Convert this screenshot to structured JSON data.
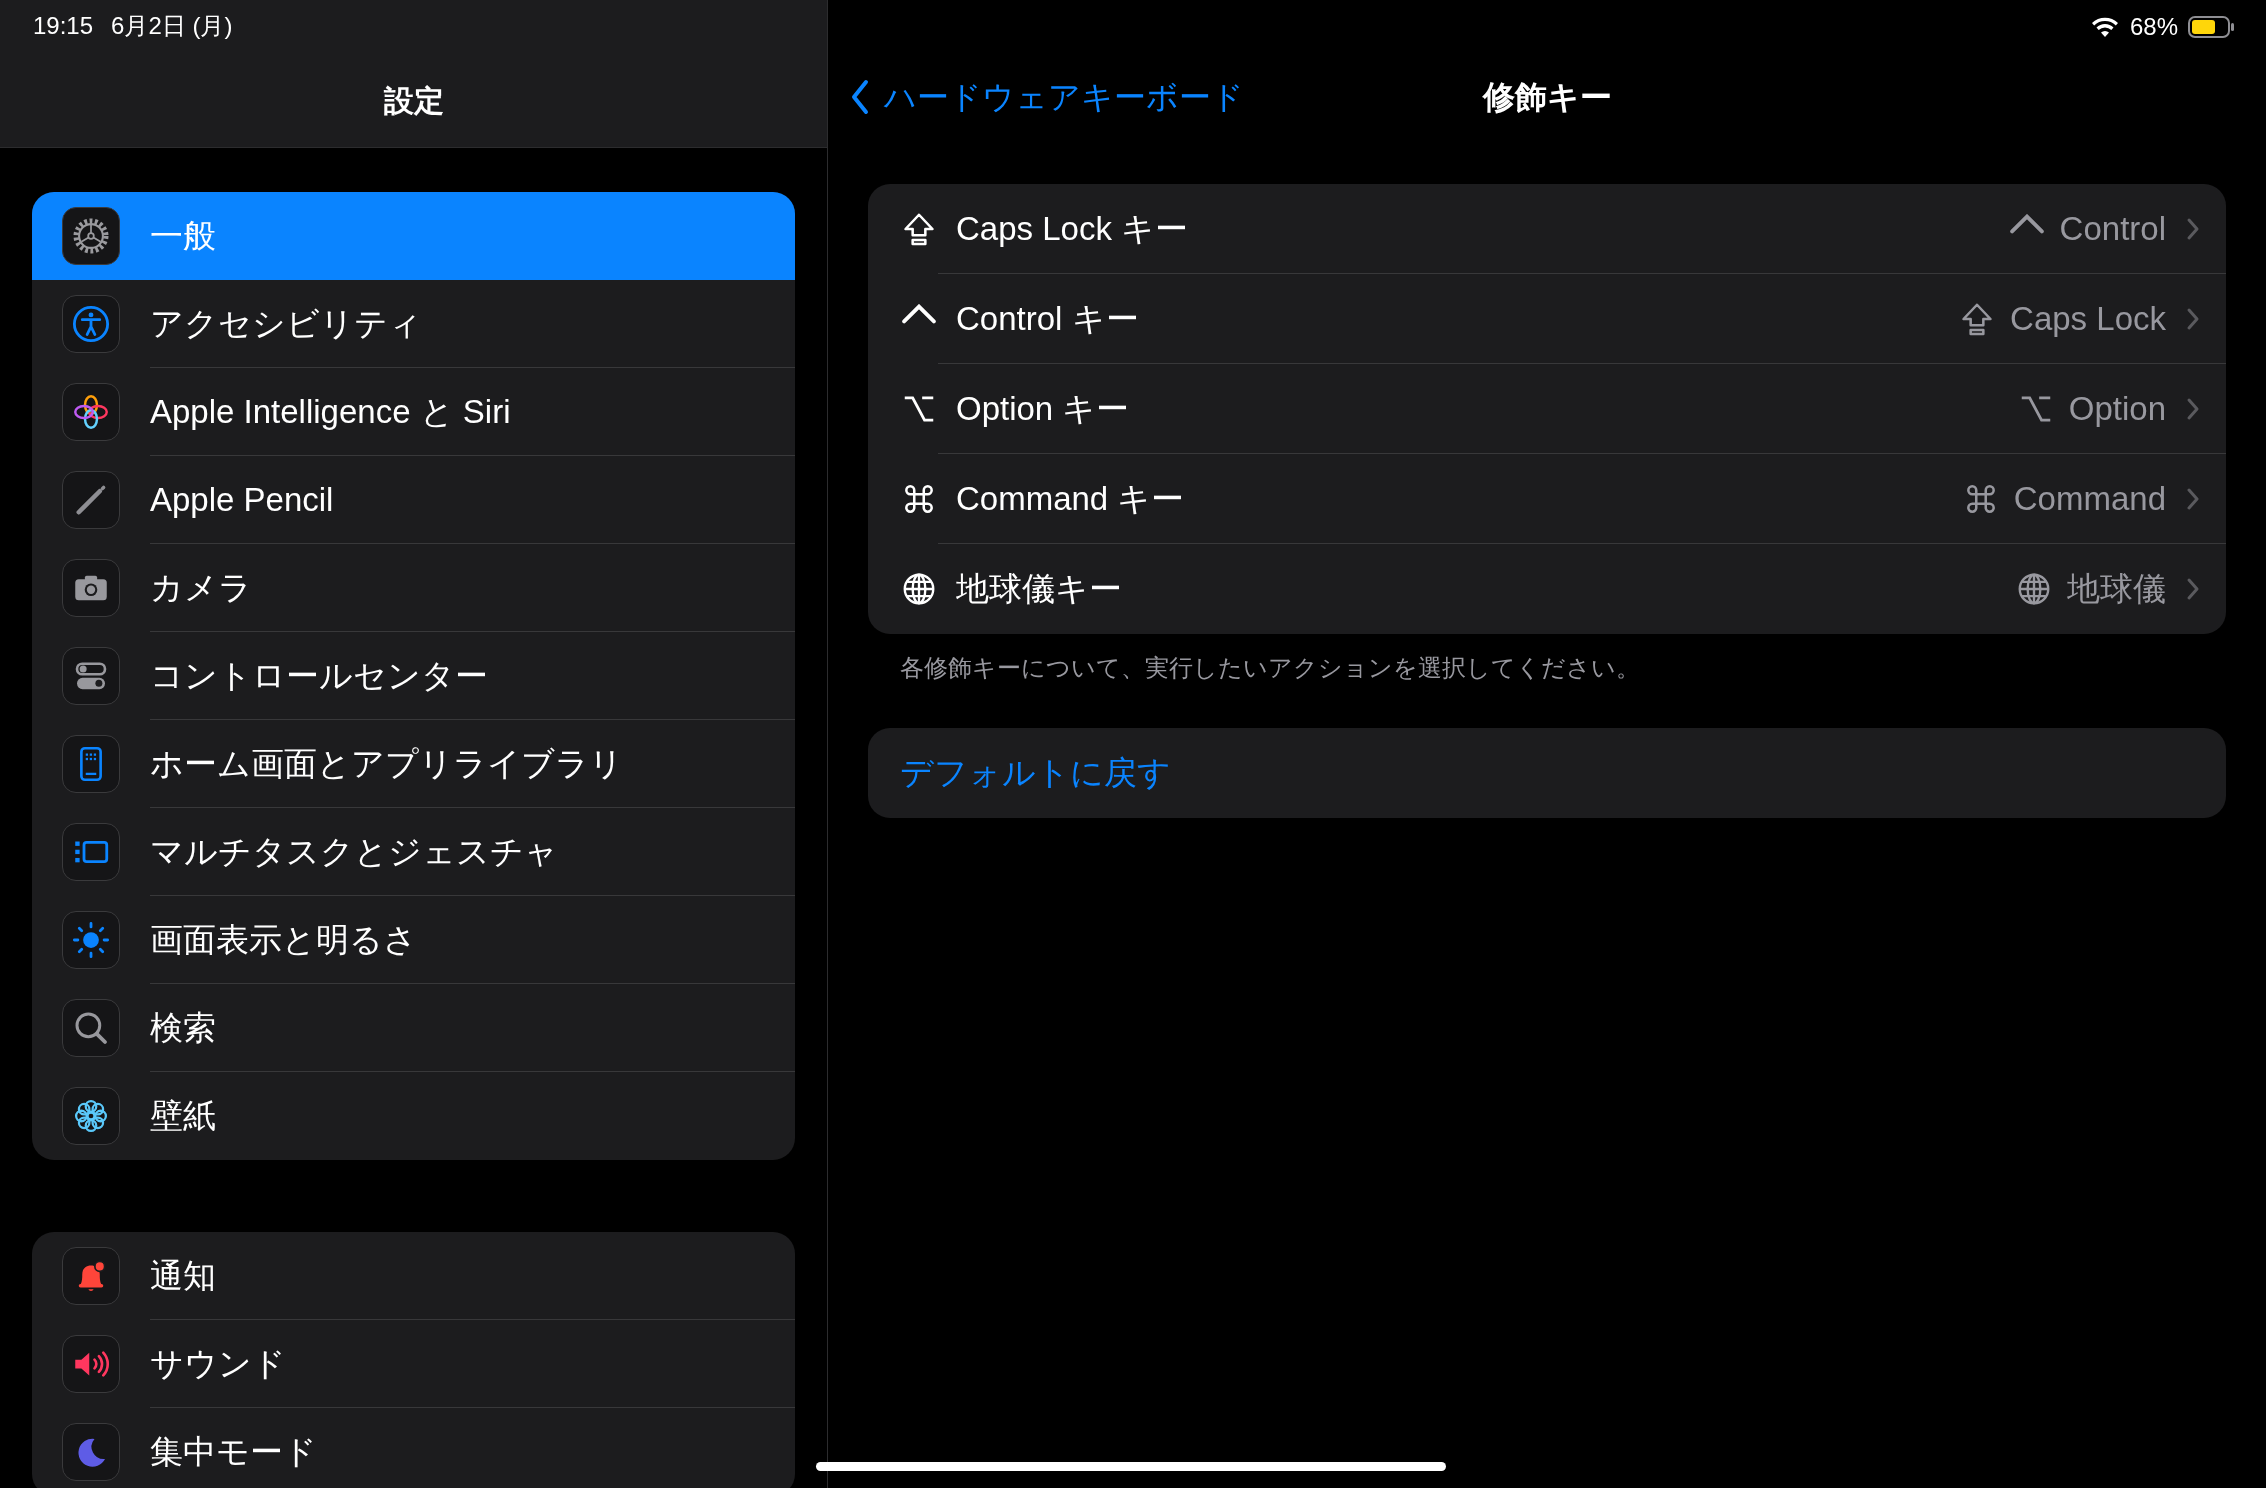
{
  "status_bar": {
    "time": "19:15",
    "date": "6月2日 (月)",
    "battery_percent": "68%"
  },
  "sidebar": {
    "title": "設定",
    "groups": [
      {
        "items": [
          {
            "label": "一般",
            "selected": true
          },
          {
            "label": "アクセシビリティ",
            "selected": false
          },
          {
            "label": "Apple Intelligence と Siri",
            "selected": false
          },
          {
            "label": "Apple Pencil",
            "selected": false
          },
          {
            "label": "カメラ",
            "selected": false
          },
          {
            "label": "コントロールセンター",
            "selected": false
          },
          {
            "label": "ホーム画面とアプリライブラリ",
            "selected": false
          },
          {
            "label": "マルチタスクとジェスチャ",
            "selected": false
          },
          {
            "label": "画面表示と明るさ",
            "selected": false
          },
          {
            "label": "検索",
            "selected": false
          },
          {
            "label": "壁紙",
            "selected": false
          }
        ]
      },
      {
        "items": [
          {
            "label": "通知",
            "selected": false
          },
          {
            "label": "サウンド",
            "selected": false
          },
          {
            "label": "集中モード",
            "selected": false
          }
        ]
      }
    ]
  },
  "detail": {
    "back_label": "ハードウェアキーボード",
    "title": "修飾キー",
    "keys": [
      {
        "label": "Caps Lock キー",
        "value": "Control"
      },
      {
        "label": "Control キー",
        "value": "Caps Lock"
      },
      {
        "label": "Option キー",
        "value": "Option"
      },
      {
        "label": "Command キー",
        "value": "Command"
      },
      {
        "label": "地球儀キー",
        "value": "地球儀"
      }
    ],
    "footer": "各修飾キーについて、実行したいアクションを選択してください。",
    "reset_button": "デフォルトに戻す"
  }
}
